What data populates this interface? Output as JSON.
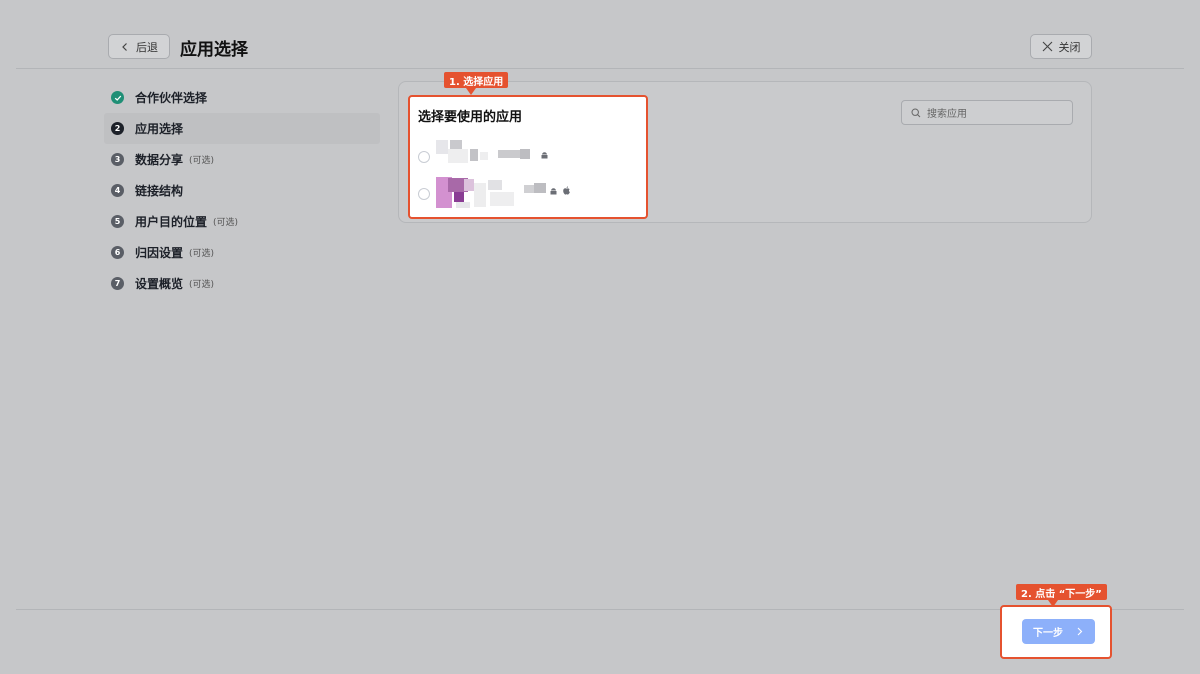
{
  "header": {
    "back_label": "后退",
    "title": "应用选择",
    "close_label": "关闭"
  },
  "steps": [
    {
      "num": "",
      "label": "合作伙伴选择",
      "optional": "",
      "state": "done"
    },
    {
      "num": "2",
      "label": "应用选择",
      "optional": "",
      "state": "active"
    },
    {
      "num": "3",
      "label": "数据分享",
      "optional": "(可选)",
      "state": "pending"
    },
    {
      "num": "4",
      "label": "链接结构",
      "optional": "",
      "state": "pending"
    },
    {
      "num": "5",
      "label": "用户目的位置",
      "optional": "(可选)",
      "state": "pending"
    },
    {
      "num": "6",
      "label": "归因设置",
      "optional": "(可选)",
      "state": "pending"
    },
    {
      "num": "7",
      "label": "设置概览",
      "optional": "(可选)",
      "state": "pending"
    }
  ],
  "main": {
    "card_title": "选择要使用的应用",
    "search_placeholder": "搜索应用",
    "apps": [
      {
        "platforms": [
          "android-icon"
        ]
      },
      {
        "platforms": [
          "android-icon",
          "apple-icon"
        ]
      }
    ]
  },
  "callouts": {
    "step1": "1. 选择应用",
    "step2": "2. 点击 “下一步”"
  },
  "footer": {
    "next_label": "下一步"
  },
  "colors": {
    "accent_highlight": "#e5522f",
    "primary_button": "#8db0fa",
    "done_step": "#1f8f76",
    "overlay_background": "#c6c7c9"
  }
}
